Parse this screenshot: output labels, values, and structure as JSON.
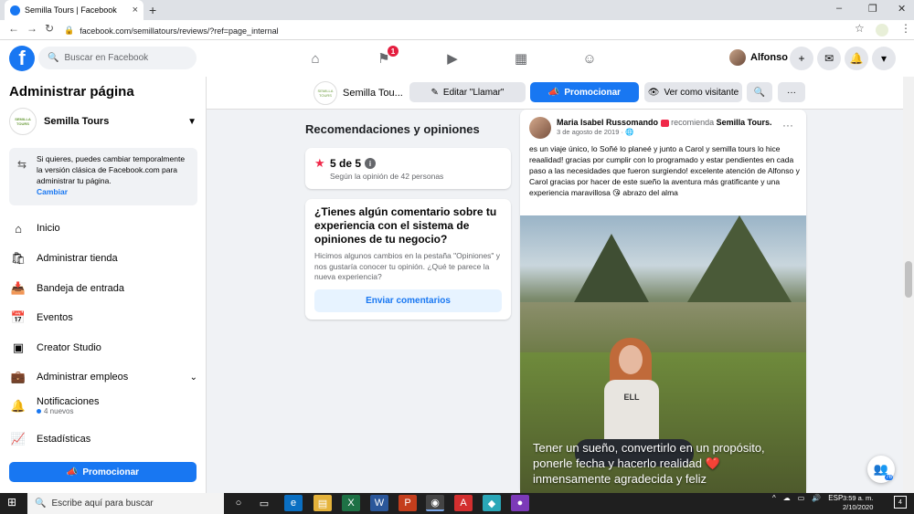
{
  "browser": {
    "tab_title": "Semilla Tours | Facebook",
    "url": "facebook.com/semillatours/reviews/?ref=page_internal",
    "new_tab": "+",
    "minimize": "–",
    "maximize": "❐",
    "close": "✕"
  },
  "fb_top": {
    "logo": "f",
    "search_placeholder": "Buscar en Facebook",
    "flag_badge": "1",
    "user_name": "Alfonso"
  },
  "sidebar": {
    "title": "Administrar página",
    "page_name": "Semilla Tours",
    "page_thumb_text": "SEMILLA TOURS",
    "classic_text": "Si quieres, puedes cambiar temporalmente la versión clásica de Facebook.com para administrar tu página.",
    "classic_link": "Cambiar",
    "items": [
      {
        "label": "Inicio",
        "icon": "home-icon"
      },
      {
        "label": "Administrar tienda",
        "icon": "shop-icon"
      },
      {
        "label": "Bandeja de entrada",
        "icon": "inbox-icon"
      },
      {
        "label": "Eventos",
        "icon": "calendar-icon"
      },
      {
        "label": "Creator Studio",
        "icon": "creator-studio-icon"
      },
      {
        "label": "Administrar empleos",
        "icon": "briefcase-icon"
      },
      {
        "label": "Notificaciones",
        "icon": "bell-icon",
        "sub": "4 nuevos"
      },
      {
        "label": "Estadísticas",
        "icon": "chart-icon"
      }
    ],
    "promote_button": "Promocionar"
  },
  "page_header": {
    "page_name": "Semilla Tou...",
    "edit_button": "Editar \"Llamar\"",
    "promote_button": "Promocionar",
    "view_as_button": "Ver como visitante"
  },
  "reviews": {
    "section_title": "Recomendaciones y opiniones",
    "score": "5 de 5",
    "score_sub": "Según la opinión de 42 personas",
    "feedback_question": "¿Tienes algún comentario sobre tu experiencia con el sistema de opiniones de tu negocio?",
    "feedback_body": "Hicimos algunos cambios en la pestaña \"Opiniones\" y nos gustaría conocer tu opinión. ¿Qué te parece la nueva experiencia?",
    "feedback_button": "Enviar comentarios"
  },
  "review_post": {
    "author": "Maria Isabel Russomando",
    "recommends": "recomienda",
    "page": "Semilla Tours.",
    "date": "3 de agosto de 2019 ·",
    "text": "es un viaje único, lo Soñé lo planeé y junto a Carol y semilla tours lo hice reaalidad! gracias por cumplir con lo programado y estar pendientes en cada paso a las necesidades que fueron surgiendo! excelente atención de Alfonso y Carol gracias por hacer de este sueño la aventura más gratificante y una experiencia maravillosa 😘 abrazo del alma",
    "photo_caption": "Tener un sueño, convertirlo en un propósito, ponerle fecha y hacerlo realidad ❤️ inmensamente agradecida y feliz",
    "shirt_text": "ELL"
  },
  "contacts_badge": "76",
  "taskbar": {
    "search_placeholder": "Escribe aquí para buscar",
    "lang": "ESP",
    "time": "3:59 a. m.",
    "date": "2/10/2020",
    "notif_count": "4"
  },
  "colors": {
    "fb_blue": "#1877f2",
    "badge_red": "#e41e3f"
  }
}
